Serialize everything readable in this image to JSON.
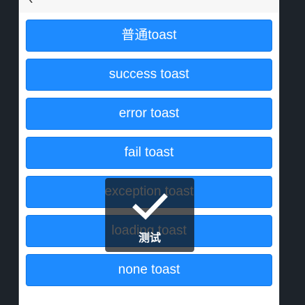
{
  "buttons": [
    {
      "label": "普通toast"
    },
    {
      "label": "success toast"
    },
    {
      "label": "error toast"
    },
    {
      "label": "fail toast"
    },
    {
      "label": "exception toast"
    },
    {
      "label": "loading toast"
    },
    {
      "label": "none toast"
    }
  ],
  "toast": {
    "icon": "checkmark-icon",
    "message": "测试"
  },
  "colors": {
    "button": "#1e8bff",
    "background": "#1d232a",
    "toast_bg": "rgba(17,17,17,0.72)"
  }
}
